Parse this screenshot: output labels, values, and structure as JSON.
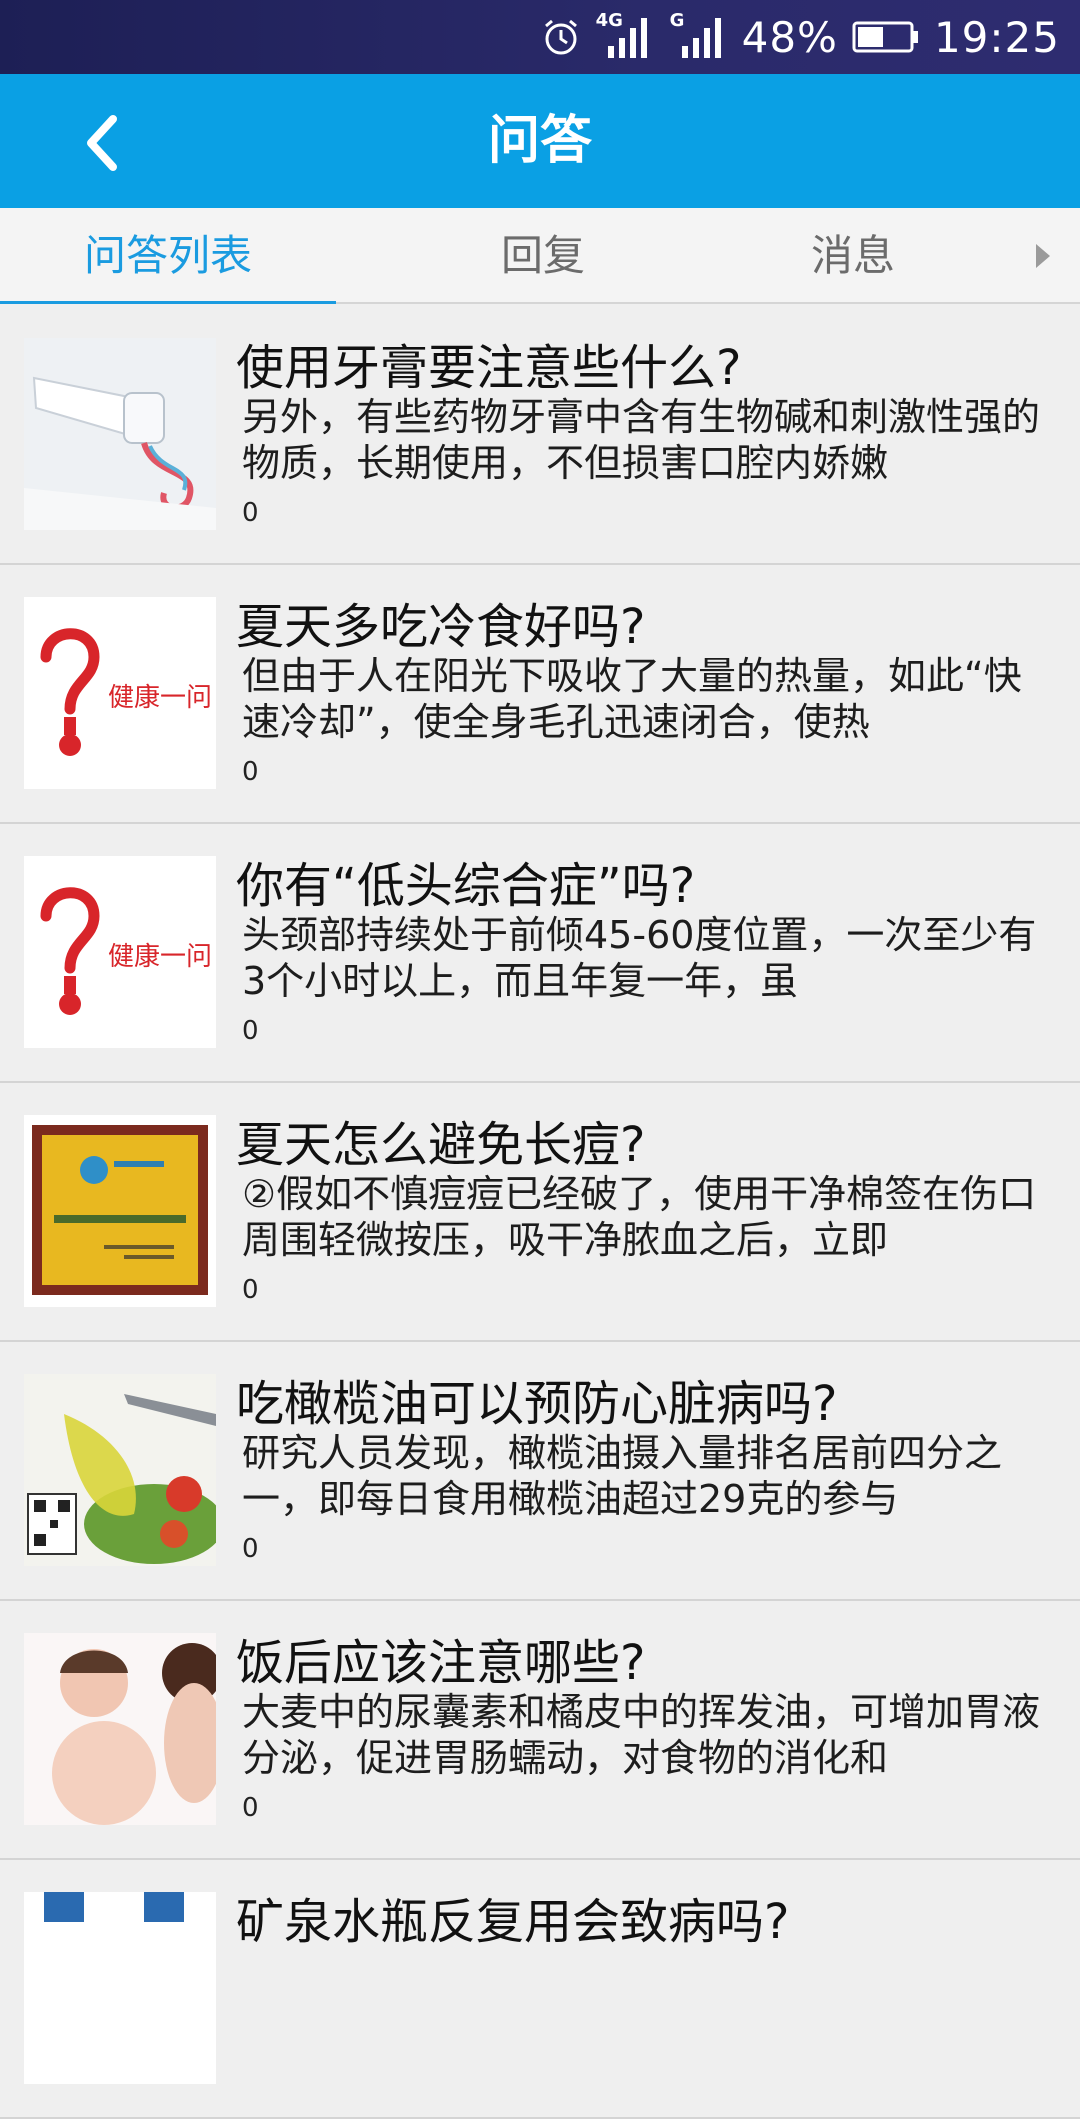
{
  "status_bar": {
    "network_1": "4G",
    "network_2": "G",
    "battery": "48%",
    "time": "19:25"
  },
  "header": {
    "title": "问答"
  },
  "tabs": [
    {
      "label": "问答列表",
      "active": true
    },
    {
      "label": "回复",
      "active": false
    },
    {
      "label": "消息",
      "active": false
    }
  ],
  "items": [
    {
      "title": "使用牙膏要注意些什么?",
      "summary": "另外，有些药物牙膏中含有生物碱和刺激性强的物质，长期使用，不但损害口腔内娇嫩",
      "count": "0",
      "thumb": "toothpaste-image"
    },
    {
      "title": "夏天多吃冷食好吗?",
      "summary": "但由于人在阳光下吸收了大量的热量，如此“快速冷却”，使全身毛孔迅速闭合，使热",
      "count": "0",
      "thumb": "health-question-image",
      "thumb_text": "健康一问"
    },
    {
      "title": "你有“低头综合症”吗?",
      "summary": "头颈部持续处于前倾45-60度位置，一次至少有3个小时以上，而且年复一年，虽",
      "count": "0",
      "thumb": "health-question-image",
      "thumb_text": "健康一问"
    },
    {
      "title": "夏天怎么避免长痘?",
      "summary": "②假如不慎痘痘已经破了，使用干净棉签在伤口周围轻微按压，吸干净脓血之后，立即",
      "count": "0",
      "thumb": "certificate-plaque-image"
    },
    {
      "title": "吃橄榄油可以预防心脏病吗?",
      "summary": "研究人员发现，橄榄油摄入量排名居前四分之一，即每日食用橄榄油超过29克的参与",
      "count": "0",
      "thumb": "olive-oil-image"
    },
    {
      "title": "饭后应该注意哪些?",
      "summary": "大麦中的尿囊素和橘皮中的挥发油，可增加胃液分泌，促进胃肠蠕动，对食物的消化和",
      "count": "0",
      "thumb": "mother-baby-image"
    },
    {
      "title": "矿泉水瓶反复用会致病吗?",
      "summary": "",
      "count": "",
      "thumb": "water-bottle-image"
    }
  ],
  "colors": {
    "status_bar": "#1d1f55",
    "header": "#0aa0e4",
    "tab_active": "#1a9be0",
    "background": "#efefef"
  }
}
